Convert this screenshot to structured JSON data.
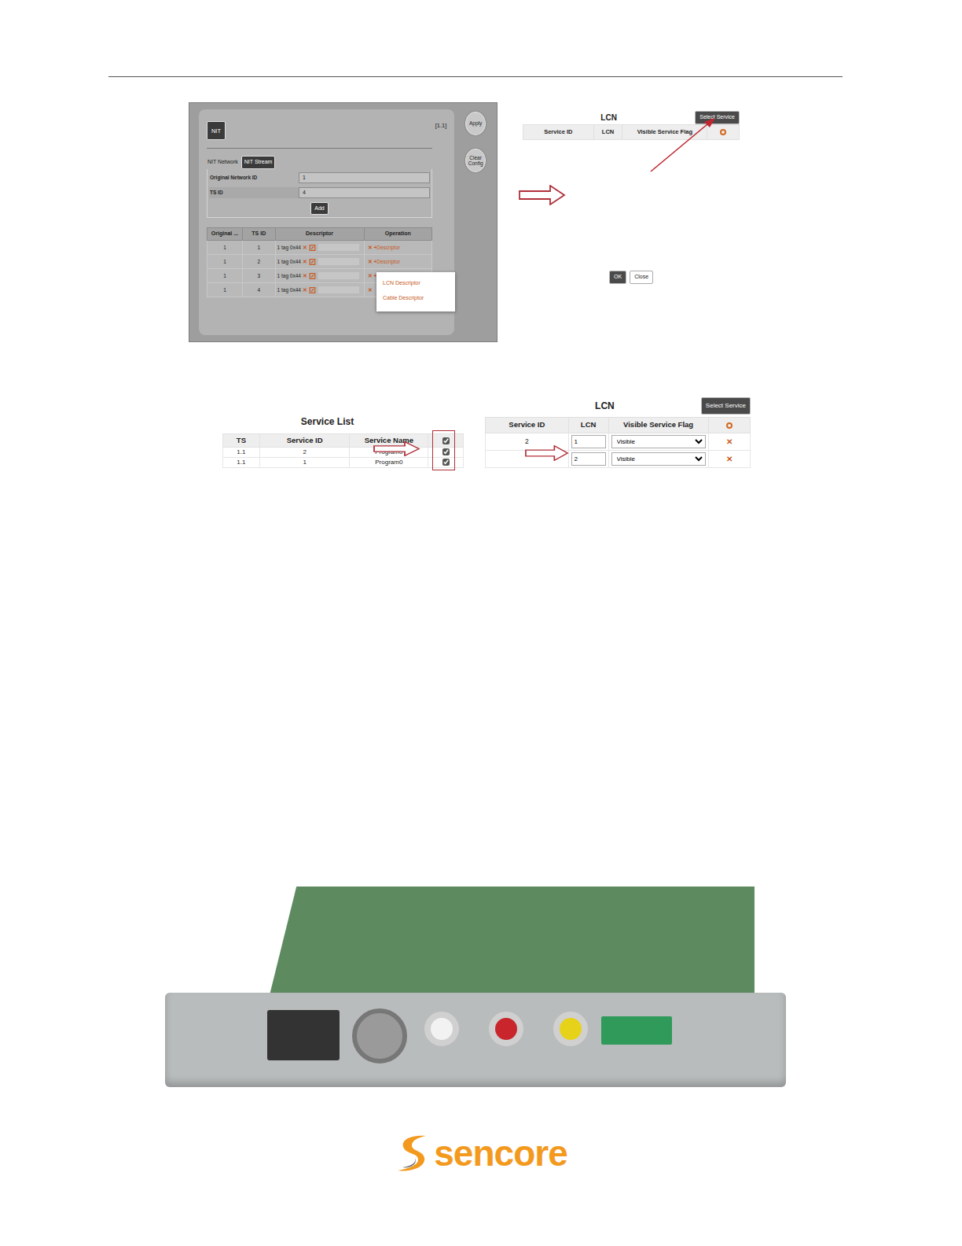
{
  "nit": {
    "title": "NIT",
    "stream": "[1.1]",
    "tabs": [
      {
        "label": "NIT Network",
        "selected": false
      },
      {
        "label": "NIT Stream",
        "selected": true
      }
    ],
    "fields": [
      {
        "label": "Original Network ID",
        "value": "1"
      },
      {
        "label": "TS ID",
        "value": "4"
      }
    ],
    "add": "Add",
    "side_buttons": [
      "Apply",
      "Clear Config"
    ],
    "table": {
      "columns": [
        "Original ...",
        "TS ID",
        "Descriptor",
        "Operation"
      ],
      "rows": [
        {
          "original": "1",
          "ts_id": "1",
          "descriptor": "1 tag 0x44",
          "remove": "✕",
          "plus": "+",
          "op": "Descriptor"
        },
        {
          "original": "1",
          "ts_id": "2",
          "descriptor": "1 tag 0x44",
          "remove": "✕",
          "plus": "+",
          "op": "Descriptor"
        },
        {
          "original": "1",
          "ts_id": "3",
          "descriptor": "1 tag 0x44",
          "remove": "✕",
          "plus": "+",
          "op": ""
        },
        {
          "original": "1",
          "ts_id": "4",
          "descriptor": "1 tag 0x44",
          "remove": "✕",
          "plus": "",
          "op": ""
        }
      ]
    },
    "menu": [
      "LCN Descriptor",
      "Cable Descriptor"
    ]
  },
  "lcn_dialog": {
    "title": "LCN",
    "select": "Select Service",
    "columns": [
      "Service ID",
      "LCN",
      "Visible Service Flag"
    ],
    "buttons": [
      {
        "label": "OK",
        "kind": "dark"
      },
      {
        "label": "Close",
        "kind": "light"
      }
    ]
  },
  "service_list": {
    "title": "Service List",
    "columns": [
      "TS",
      "Service ID",
      "Service Name"
    ],
    "header_checked": true,
    "rows": [
      {
        "ts": "1.1",
        "service_id": "2",
        "name": "Program0",
        "checked": true
      },
      {
        "ts": "1.1",
        "service_id": "1",
        "name": "Program0",
        "checked": true
      }
    ]
  },
  "lcn": {
    "title": "LCN",
    "select": "Select Service",
    "columns": [
      "Service ID",
      "LCN",
      "Visible Service Flag"
    ],
    "rows": [
      {
        "service_id": "2",
        "lcn": "1",
        "flag": "Visible",
        "remove": "✕"
      },
      {
        "service_id": "",
        "lcn": "2",
        "flag": "Visible",
        "remove": "✕"
      }
    ]
  },
  "logo": {
    "text": "sencore"
  }
}
